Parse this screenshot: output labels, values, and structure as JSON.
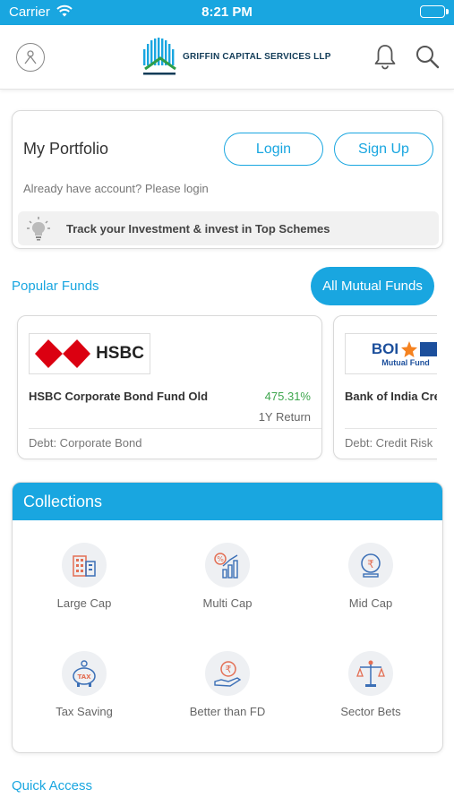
{
  "status_bar": {
    "carrier": "Carrier",
    "time": "8:21 PM"
  },
  "header": {
    "brand": "GRIFFIN CAPITAL SERVICES LLP"
  },
  "portfolio": {
    "title": "My Portfolio",
    "login_label": "Login",
    "signup_label": "Sign Up",
    "hint": "Already have account? Please login",
    "track_text": "Track your Investment & invest in Top Schemes"
  },
  "popular": {
    "label": "Popular Funds",
    "all_funds_label": "All Mutual Funds"
  },
  "funds": [
    {
      "logo_text": "HSBC",
      "name": "HSBC Corporate Bond Fund Old",
      "return_value": "475.31%",
      "return_label": "1Y Return",
      "category": "Debt: Corporate Bond"
    },
    {
      "logo_text": "BOI",
      "logo_sub": "Mutual Fund",
      "name": "Bank of India Cre",
      "category": "Debt: Credit Risk"
    }
  ],
  "collections": {
    "title": "Collections",
    "items": [
      {
        "label": "Large Cap",
        "icon": "building-icon"
      },
      {
        "label": "Multi Cap",
        "icon": "growth-chart-icon"
      },
      {
        "label": "Mid Cap",
        "icon": "rupee-globe-icon"
      },
      {
        "label": "Tax Saving",
        "icon": "piggy-bank-icon"
      },
      {
        "label": "Better than FD",
        "icon": "hand-rupee-icon"
      },
      {
        "label": "Sector Bets",
        "icon": "scale-icon"
      }
    ]
  },
  "quick_access": {
    "label": "Quick Access"
  },
  "colors": {
    "accent": "#19a6e0",
    "positive": "#3ea64e",
    "hsbc_red": "#db0011",
    "boi_blue": "#1c4f9c"
  }
}
